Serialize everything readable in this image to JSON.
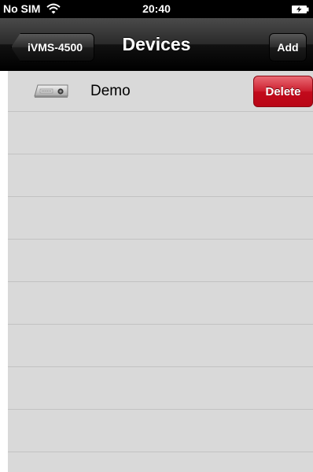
{
  "status_bar": {
    "carrier": "No SIM",
    "time": "20:40",
    "wifi_icon": "wifi-icon",
    "battery_icon": "battery-charging-icon"
  },
  "nav": {
    "back_label": "iVMS-4500",
    "title": "Devices",
    "add_label": "Add"
  },
  "devices": [
    {
      "name": "Demo",
      "icon": "dvr-device-icon",
      "delete_label": "Delete"
    }
  ],
  "colors": {
    "delete": "#c8182a",
    "list_background": "#d9d9d9",
    "nav_bar": "#1a1a1a"
  }
}
